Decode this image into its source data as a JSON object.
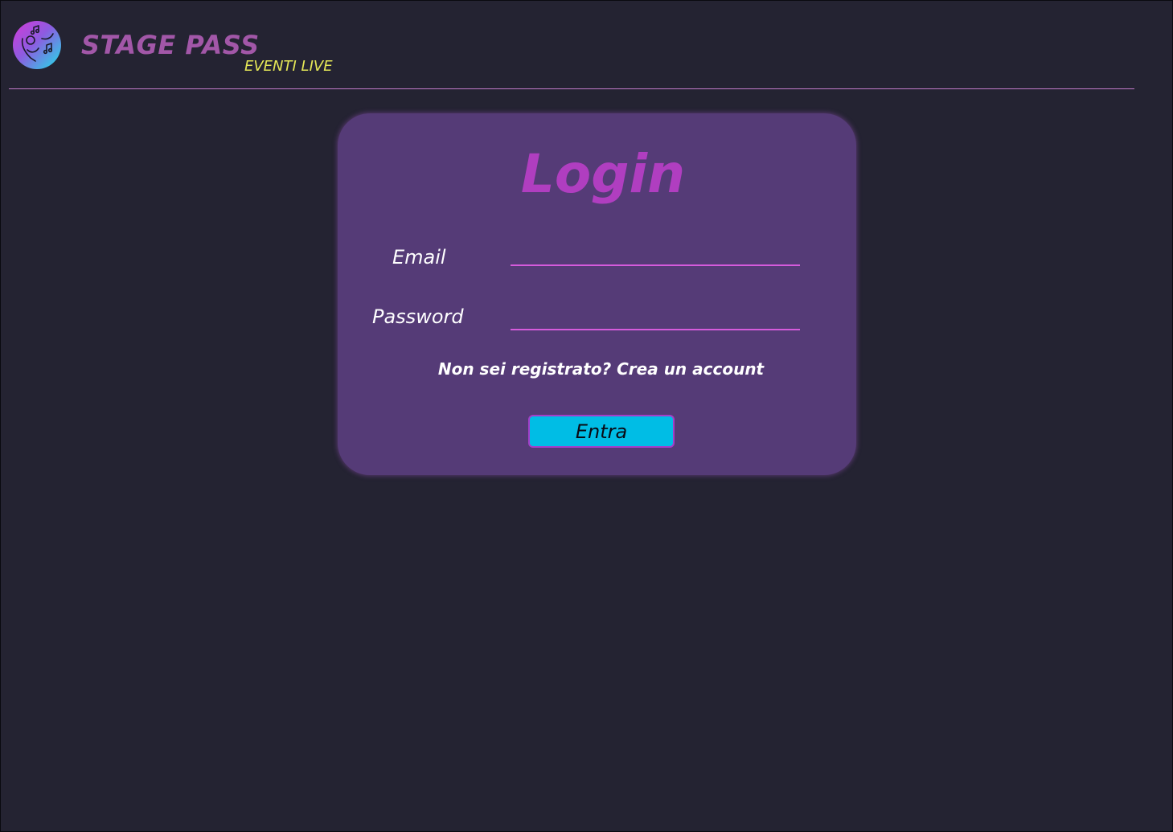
{
  "header": {
    "brand": "STAGE PASS",
    "tagline": "EVENTI LIVE",
    "logo_icon": "music-hand-icon"
  },
  "login": {
    "title": "Login",
    "email_label": "Email",
    "email_value": "",
    "password_label": "Password",
    "password_value": "",
    "register_link": "Non sei registrato? Crea un account",
    "submit_label": "Entra"
  },
  "colors": {
    "background": "#242332",
    "card": "#553b77",
    "brand": "#a257a8",
    "tagline": "#e4e657",
    "title": "#b03ec0",
    "input_underline": "#d55bdc",
    "button": "#00bde5",
    "button_border": "#a43fc9"
  }
}
